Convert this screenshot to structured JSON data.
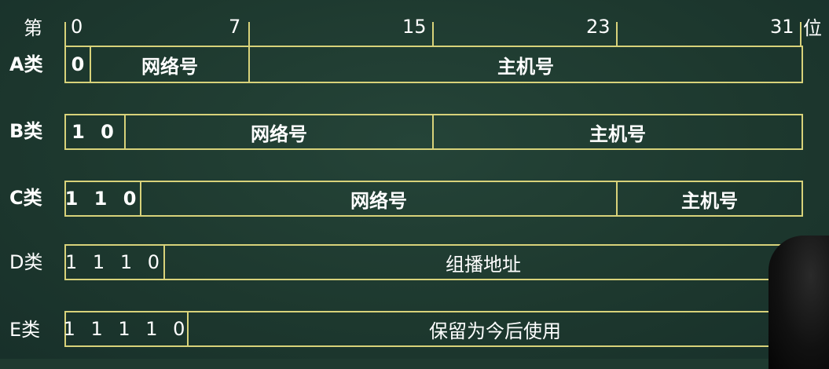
{
  "header": {
    "left_label": "第",
    "right_label": "位",
    "bit_positions": [
      "0",
      "7",
      "15",
      "23",
      "31"
    ]
  },
  "rows": [
    {
      "label": "A类",
      "segments": [
        {
          "text": "0",
          "bits": 1
        },
        {
          "text": "网络号",
          "bits": 7
        },
        {
          "text": "主机号",
          "bits": 24
        }
      ]
    },
    {
      "label": "B类",
      "segments": [
        {
          "text": "1 0",
          "bits": 2
        },
        {
          "text": "网络号",
          "bits": 14
        },
        {
          "text": "主机号",
          "bits": 16
        }
      ]
    },
    {
      "label": "C类",
      "segments": [
        {
          "text": "1 1 0",
          "bits": 3
        },
        {
          "text": "网络号",
          "bits": 21
        },
        {
          "text": "主机号",
          "bits": 8
        }
      ]
    },
    {
      "label": "D类",
      "segments": [
        {
          "text": "1 1 1 0",
          "bits": 4
        },
        {
          "text": "组播地址",
          "bits": 28
        }
      ]
    },
    {
      "label": "E类",
      "segments": [
        {
          "text": "1 1 1 1 0",
          "bits": 5
        },
        {
          "text": "保留为今后使用",
          "bits": 27
        }
      ]
    }
  ]
}
